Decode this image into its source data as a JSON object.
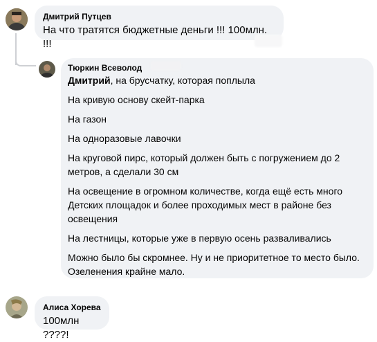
{
  "comments": [
    {
      "author": "Дмитрий Путцев",
      "text": "На что тратятся бюджетные деньги !!! 100млн. !!!"
    },
    {
      "author": "Тюркин Всеволод",
      "mention": "Дмитрий",
      "first_line_rest": ", на брусчатку, которая поплыла",
      "paragraphs": [
        "На кривую основу скейт-парка",
        "На газон",
        "На одноразовые лавочки",
        "На круговой пирс, который должен быть с погружением до 2 метров, а сделали 30 см",
        "На освещение в огромном количестве, когда ещё есть много Детских площадок и более проходимых мест в районе без освещения",
        "На лестницы, которые уже в первую осень разваливались",
        "Можно было бы скромнее. Ну и не приоритетное то место было. Озеленения крайне мало."
      ]
    },
    {
      "author": "Алиса Хорева",
      "text": "100млн ????!"
    }
  ],
  "colors": {
    "bubble": "#f0f2f5",
    "thread_line": "#ced0d4",
    "text": "#050505"
  }
}
